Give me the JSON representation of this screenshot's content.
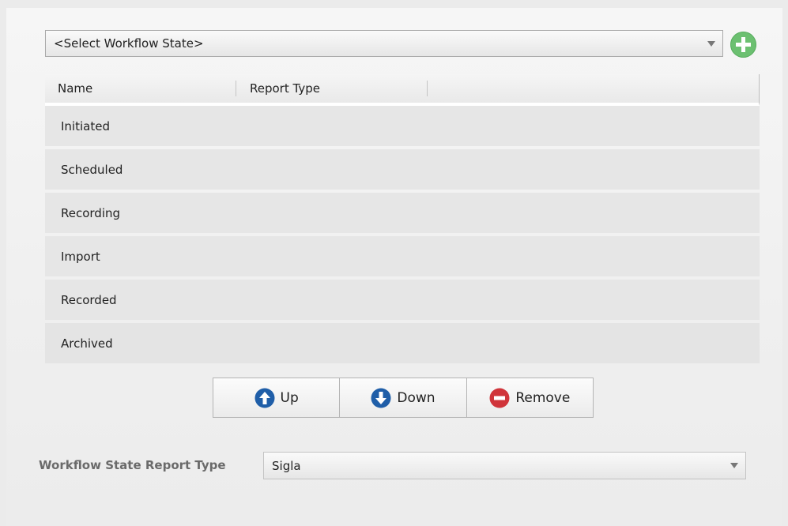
{
  "workflow_select": {
    "value": "<Select Workflow State>"
  },
  "add_button": {
    "icon": "add-icon",
    "color": "#6cc071"
  },
  "grid": {
    "columns": [
      "Name",
      "Report Type"
    ],
    "rows": [
      "Initiated",
      "Scheduled",
      "Recording",
      "Import",
      "Recorded",
      "Archived"
    ]
  },
  "actions": {
    "up": {
      "label": "Up",
      "icon": "arrow-up-circle-icon",
      "color": "#1f5ea8"
    },
    "down": {
      "label": "Down",
      "icon": "arrow-down-circle-icon",
      "color": "#1f5ea8"
    },
    "remove": {
      "label": "Remove",
      "icon": "minus-circle-icon",
      "color": "#d0343a"
    }
  },
  "report_type": {
    "label": "Workflow State Report Type",
    "value": "Sigla"
  }
}
